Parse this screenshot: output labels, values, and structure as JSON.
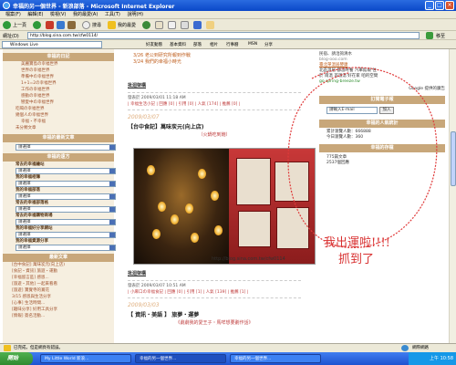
{
  "window": {
    "title": "幸福的另一個世界 - 新浪部落 - Microsoft Internet Explorer",
    "min_glyph": "_",
    "max_glyph": "□",
    "close_glyph": "×"
  },
  "menu": [
    "檔案(F)",
    "編輯(E)",
    "檢視(V)",
    "我的最愛(A)",
    "工具(T)",
    "說明(H)"
  ],
  "toolbar": {
    "back": "上一頁",
    "search": "搜尋",
    "favorites": "我的最愛"
  },
  "address": {
    "label": "網址(D)",
    "url": "http://blog.sina.com.tw/cfw0114/",
    "go_label": "移至"
  },
  "links_bar": {
    "windows_live": "Windows Live",
    "items": [
      "好友動態",
      "基本資料",
      "部落",
      "相片",
      "行事曆",
      "MSN",
      "分享"
    ]
  },
  "left": {
    "box1_title": "幸福的日記",
    "links": [
      "美麗寶島の幸福世界",
      "世界の幸福世界",
      "準備中の幸福世界",
      "1+1=2の幸福世界",
      "工作の幸福世界",
      "感動の幸福世界",
      "戀愛中の幸福世界",
      "吃喝の幸福世界",
      "幾個人の幸福世界",
      "幸福・不幸福",
      "未分類文章"
    ],
    "box2_title": "幸福的最新文章",
    "select_placeholder": "請選擇",
    "box3_title": "幸福的遠方",
    "fav_groups": [
      {
        "label": "常去的幸福繪站",
        "options": [
          "請選擇"
        ]
      },
      {
        "label": "我的幸福相簿",
        "options": [
          "請選擇"
        ]
      },
      {
        "label": "我的幸福部落",
        "options": [
          "請選擇"
        ]
      },
      {
        "label": "常去的幸福部落格",
        "options": [
          "請選擇"
        ]
      },
      {
        "label": "常去的幸福購物商場",
        "options": [
          "請選擇"
        ]
      },
      {
        "label": "我的幸福好分享網站",
        "options": [
          "請選擇"
        ]
      },
      {
        "label": "我的幸福資源分享",
        "options": [
          "請選擇"
        ]
      }
    ],
    "box4_title": "最新文章",
    "recent": [
      "[台中食記] 萬味炭元(向上店)",
      "[食記・資訊] 旅遊・運動",
      "[幸福留言區] 感恩...",
      "[旅遊・其他] 一起來看看",
      "[旅遊] 寶覺寺的賞花",
      "3/15 感恩與生活分享",
      "[心事] 生活時間...",
      "[趣味分享] 好用工具分享",
      "[情報] 簽名活動..."
    ]
  },
  "middle": {
    "top_links": [
      "3/26 老公到研究所報到作戰",
      "3/24 我們的幸福小時光"
    ],
    "reprint1": "批迴架構",
    "post1_meta": "發表於 2009/03/01 11:18 AM",
    "post1_links": "| 幸福生活小記 | 回應 [0] | 引用 [0] | 人氣 [174] | 推薦 [0] |",
    "post1_date": "2009/03/07",
    "post1_title": "【台中食記】萬味炭元(向上店)",
    "post1_sub": "（火鍋吃到飽）",
    "watermark": "http://blog.sina.com.tw/cfw0114",
    "reprint2": "批迴架構",
    "post2_meta": "發表於 2009/03/07 10:51 AM",
    "post2_links": "| 小麻口の幸福食記 | 回應 [0] | 引用 [1] | 人氣 [139] | 推薦 [1] |",
    "post2_date": "2009/03/03",
    "post2_title": "【 資訊・美語 】 旅夢・運夢",
    "post2_sub": "《劇劇我的愛王子・馬咩想要劃作話》"
  },
  "right": {
    "ad_lines": [
      "民宿、請洽詢清水",
      "blog-ooo.com",
      "臺北單溫居嬰康",
      "北區溫居 都溫咚養 汽車館報 住",
      "於 雨溫 首溫溫 好在家 咱的空間",
      "go.spring-breeze.tw"
    ],
    "google_label": "Google 提供的廣告",
    "subscribe_title": "訂閱電子報",
    "email_placeholder": "請輸入E-mail",
    "join_btn": "加入",
    "counter_title": "幸福的人氣統計",
    "counter_lines": [
      "累計瀏覽人數：666888",
      "今日瀏覽人數：360"
    ],
    "archive_title": "幸福的存檔",
    "archive_lines": [
      "775篇文章",
      "2537個回應"
    ]
  },
  "annotation": {
    "line1": "我出運啦!!!!",
    "line2": "抓到了"
  },
  "status": {
    "text": "已完成，但是網頁有錯誤。",
    "zone": "網際網路"
  },
  "taskbar": {
    "start": "開始",
    "tasks": [
      "My Little World 新浪...",
      "幸福的另一個世界...",
      "幸福的另一個世界..."
    ],
    "clock": "上午 10:58"
  }
}
